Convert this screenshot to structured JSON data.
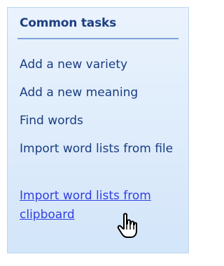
{
  "panel": {
    "title": "Common tasks",
    "tasks": [
      {
        "label": "Add a new variety"
      },
      {
        "label": "Add a new meaning"
      },
      {
        "label": "Find words"
      },
      {
        "label": "Import word lists from file"
      },
      {
        "label": "Import word lists from clipboard",
        "hovered": true
      }
    ]
  },
  "colors": {
    "panel_top": "#eaf3fd",
    "panel_bottom": "#d3e5f9",
    "title": "#1f3f83",
    "link": "#1a3e82",
    "link_hover": "#2f3fe0",
    "divider": "#7ba3d8"
  },
  "cursor": {
    "icon": "hand-pointer-icon"
  }
}
